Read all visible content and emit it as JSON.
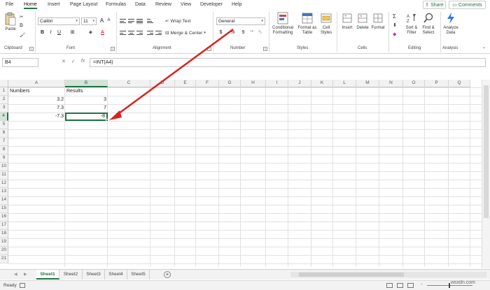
{
  "menu": {
    "tabs": [
      "File",
      "Home",
      "Insert",
      "Page Layout",
      "Formulas",
      "Data",
      "Review",
      "View",
      "Developer",
      "Help"
    ],
    "active_tab": "Home",
    "share_label": "Share",
    "comments_label": "Comments"
  },
  "ribbon": {
    "clipboard": {
      "paste_label": "Paste",
      "group_label": "Clipboard"
    },
    "font": {
      "font_name": "Calibri",
      "font_size": "11",
      "bold": "B",
      "italic": "I",
      "underline": "U",
      "group_label": "Font"
    },
    "alignment": {
      "wrap_text": "Wrap Text",
      "merge_center": "Merge & Center",
      "group_label": "Alignment"
    },
    "number": {
      "format": "General",
      "currency": "$",
      "percent": "%",
      "comma": "9",
      "group_label": "Number"
    },
    "styles": {
      "conditional_formatting": "Conditional Formatting",
      "format_as_table": "Format as Table",
      "cell_styles": "Cell Styles",
      "group_label": "Styles"
    },
    "cells": {
      "insert": "Insert",
      "delete": "Delete",
      "format": "Format",
      "group_label": "Cells"
    },
    "editing": {
      "sort_filter": "Sort & Filter",
      "find_select": "Find & Select",
      "group_label": "Editing"
    },
    "analysis": {
      "analyze_data": "Analyze Data",
      "group_label": "Analysis"
    }
  },
  "formula_bar": {
    "name_box": "B4",
    "fx": "fx",
    "formula": "=INT(A4)"
  },
  "columns": [
    "A",
    "B",
    "C",
    "D",
    "E",
    "F",
    "G",
    "H",
    "I",
    "J",
    "K",
    "L",
    "M",
    "N",
    "O",
    "P",
    "Q"
  ],
  "rows": [
    "1",
    "2",
    "3",
    "4",
    "5",
    "6",
    "7",
    "8",
    "9",
    "10",
    "11",
    "12",
    "13",
    "14",
    "15",
    "16",
    "17",
    "18",
    "19",
    "20",
    "21"
  ],
  "cells": {
    "A1": "Numbers",
    "B1": "Results",
    "A2": "3.2",
    "B2": "3",
    "A3": "7.3",
    "B3": "7",
    "A4": "-7.3",
    "B4": "-8"
  },
  "active_cell": "B4",
  "sheets": [
    "Sheet1",
    "Sheet2",
    "Sheet3",
    "Sheet4",
    "Sheet5"
  ],
  "active_sheet": "Sheet1",
  "status": {
    "ready": "Ready",
    "zoom_minus": "-",
    "zoom_plus": "+"
  },
  "watermark": "wsxdn.com",
  "colors": {
    "accent": "#217346",
    "annotation_arrow": "#d9231c"
  }
}
